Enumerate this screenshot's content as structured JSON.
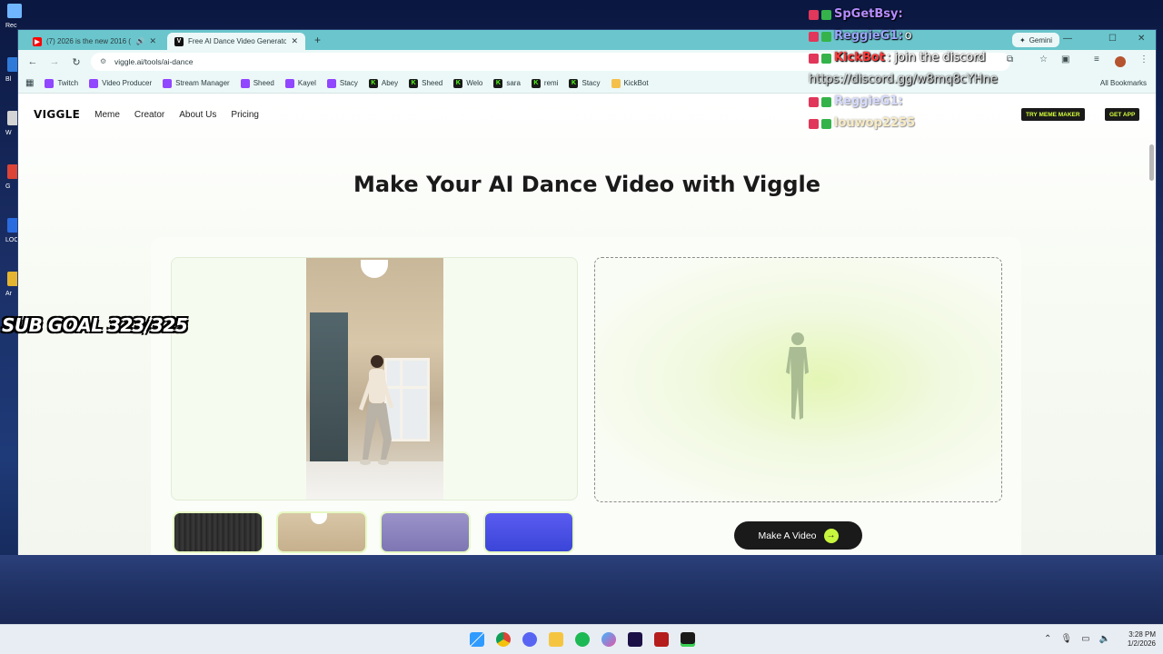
{
  "desktop": {
    "icons": [
      {
        "label": "Rec",
        "color": "#6fb6ff"
      },
      {
        "label": "Bl",
        "color": "#2f7ad9"
      },
      {
        "label": "W",
        "color": "#d4d4d4"
      },
      {
        "label": "G",
        "color": "#db4437"
      },
      {
        "label": "LOC",
        "color": "#2b6be0"
      },
      {
        "label": "Ar",
        "color": "#e5b532"
      }
    ]
  },
  "browser": {
    "tabs": [
      {
        "title": "(7) 2026 is the new 2016 (p",
        "icon": "youtube-icon",
        "color": "#ff0000",
        "active": false
      },
      {
        "title": "Free AI Dance Video Generato",
        "icon": "viggle-icon",
        "color": "#111111",
        "active": true
      }
    ],
    "new_tab": "+",
    "gemini_label": "Gemini",
    "url": "viggle.ai/tools/ai-dance",
    "bookmarks": [
      {
        "label": "Twitch",
        "type": "tw"
      },
      {
        "label": "Video Producer",
        "type": "tw"
      },
      {
        "label": "Stream Manager",
        "type": "tw"
      },
      {
        "label": "Sheed",
        "type": "tw"
      },
      {
        "label": "Kayel",
        "type": "tw"
      },
      {
        "label": "Stacy",
        "type": "tw"
      },
      {
        "label": "Abey",
        "type": "k"
      },
      {
        "label": "Sheed",
        "type": "k"
      },
      {
        "label": "Welo",
        "type": "k"
      },
      {
        "label": "sara",
        "type": "k"
      },
      {
        "label": "remi",
        "type": "k"
      },
      {
        "label": "Stacy",
        "type": "k"
      },
      {
        "label": "KickBot",
        "type": "kb"
      }
    ],
    "all_bookmarks": "All Bookmarks"
  },
  "site": {
    "logo": "VIGGLE",
    "nav": [
      "Meme",
      "Creator",
      "About Us",
      "Pricing"
    ],
    "try_meme": "TRY MEME MAKER",
    "get_app": "GET APP",
    "heading": "Make Your AI Dance Video with Viggle",
    "make_video": "Make A Video",
    "accent": "#c8f53d"
  },
  "chat": [
    {
      "user": "SpGetBsy:",
      "msg": "",
      "user_class": "u1"
    },
    {
      "user": "ReggieG1:",
      "msg": "o",
      "user_class": "u2"
    },
    {
      "user": "KickBot",
      "msg": ": join the discord",
      "user_class": "u3"
    },
    {
      "user": "",
      "msg": "https://discord.gg/w8mq8cYHne",
      "user_class": "u3"
    },
    {
      "user": "ReggieG1:",
      "msg": "",
      "user_class": "u2",
      "faded": true
    },
    {
      "user": "louwop2255",
      "msg": "",
      "user_class": "u4",
      "faded": true
    }
  ],
  "overlay": {
    "sub_goal": "SUB GOAL 323/325"
  },
  "taskbar": {
    "time": "3:28 PM",
    "date": "1/2/2026"
  }
}
